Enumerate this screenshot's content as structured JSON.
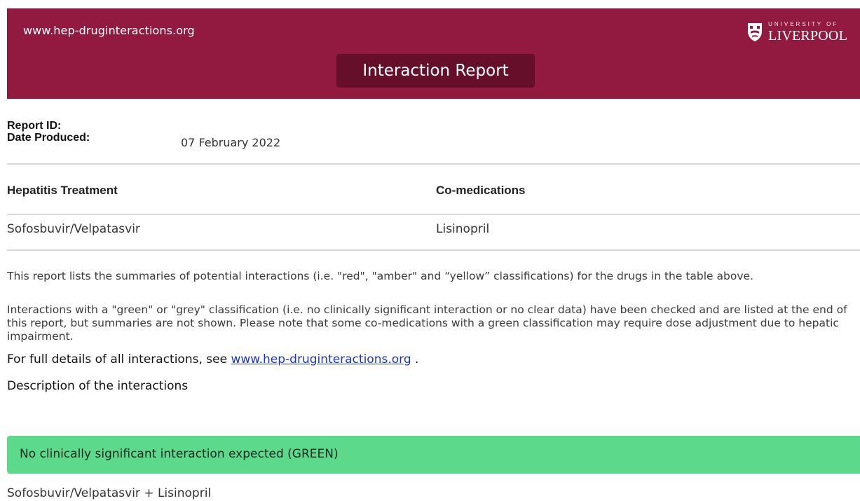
{
  "header": {
    "site_url": "www.hep-druginteractions.org",
    "title": "Interaction Report",
    "logo": {
      "small_text": "UNIVERSITY OF",
      "main_text": "LIVERPOOL",
      "icon": "shield-crest-icon"
    },
    "colors": {
      "banner": "#921a41",
      "title_bg": "#650f2b"
    }
  },
  "meta": {
    "report_id_label": "Report ID:",
    "date_label": "Date Produced:",
    "date_value": "07 February 2022"
  },
  "table": {
    "headers": [
      "Hepatitis Treatment",
      "Co-medications"
    ],
    "row": [
      "Sofosbuvir/Velpatasvir",
      "Lisinopril"
    ]
  },
  "body": {
    "p1": "This report lists the summaries of potential interactions (i.e. \"red\", \"amber\" and “yellow” classifications) for the drugs in the table above.",
    "p2": "Interactions with a \"green\" or \"grey\" classification (i.e. no clinically significant interaction or no clear data) have been checked and are listed at the end of this report, but summaries are not shown. Please note that some co-medications with a green classification may require dose adjustment due to hepatic impairment.",
    "full_details_prefix": "For full details of all interactions, see ",
    "full_details_link": "www.hep-druginteractions.org",
    "full_details_suffix": " .",
    "description_heading": "Description of the interactions"
  },
  "interaction": {
    "classification": "No clinically significant interaction expected (GREEN)",
    "color": "#5dd98b",
    "combination": "Sofosbuvir/Velpatasvir + Lisinopril"
  }
}
